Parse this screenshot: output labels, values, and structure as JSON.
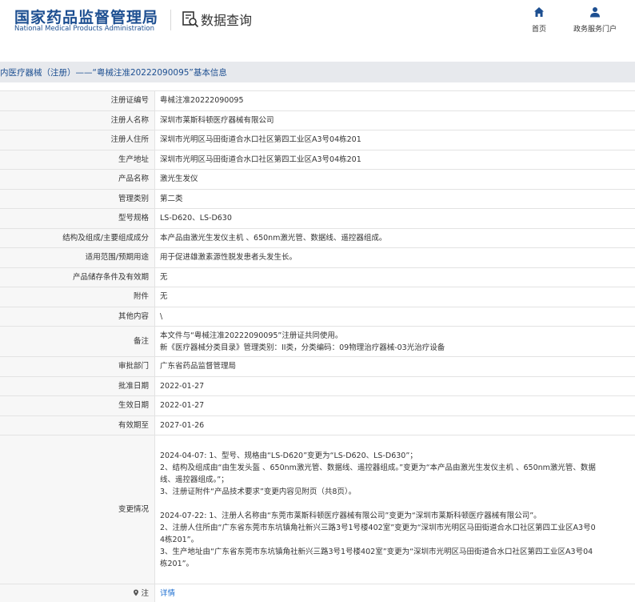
{
  "header": {
    "logo_cn": "国家药品监督管理局",
    "logo_en": "National Medical Products Administration",
    "section_title": "数据查询",
    "nav": {
      "home": "首页",
      "service": "政务服务门户"
    }
  },
  "breadcrumb": "内医疗器械（注册）——“粤械注准20222090095”基本信息",
  "colors": {
    "brand_blue": "#1d4f91",
    "link_blue": "#1d6fd1",
    "label_bg": "#f7f7f7",
    "crumb_bg": "#e7e9ed"
  },
  "rows": [
    {
      "label": "注册证编号",
      "value": "粤械注准20222090095"
    },
    {
      "label": "注册人名称",
      "value": "深圳市莱斯科顿医疗器械有限公司"
    },
    {
      "label": "注册人住所",
      "value": "深圳市光明区马田街道合水口社区第四工业区A3号04栋201"
    },
    {
      "label": "生产地址",
      "value": "深圳市光明区马田街道合水口社区第四工业区A3号04栋201"
    },
    {
      "label": "产品名称",
      "value": "激光生发仪"
    },
    {
      "label": "管理类别",
      "value": "第二类"
    },
    {
      "label": "型号规格",
      "value": "LS-D620、LS-D630"
    },
    {
      "label": "结构及组成/主要组成成分",
      "value": "本产品由激光生发仪主机 、650nm激光管、数据线、遥控器组成。"
    },
    {
      "label": "适用范围/预期用途",
      "value": "用于促进雄激素源性脱发患者头发生长。"
    },
    {
      "label": "产品储存条件及有效期",
      "value": "无"
    },
    {
      "label": "附件",
      "value": "无"
    },
    {
      "label": "其他内容",
      "value": "\\"
    }
  ],
  "remark": {
    "label": "备注",
    "lines": [
      "本文件与“粤械注准20222090095”注册证共同使用。",
      "新《医疗器械分类目录》管理类别：II类，分类编码：09物理治疗器械-03光治疗设备"
    ]
  },
  "rows2": [
    {
      "label": "审批部门",
      "value": "广东省药品监督管理局"
    },
    {
      "label": "批准日期",
      "value": "2022-01-27"
    },
    {
      "label": "生效日期",
      "value": "2022-01-27"
    },
    {
      "label": "有效期至",
      "value": "2027-01-26"
    }
  ],
  "changes": {
    "label": "变更情况",
    "block1": [
      "2024-04-07: 1、型号、规格由“LS-D620”变更为“LS-D620、LS-D630”；",
      "2、结构及组成由“由生发头盔 、650nm激光管、数据线、遥控器组成。”变更为“本产品由激光生发仪主机 、650nm激光管、数据",
      "线、遥控器组成。”；",
      "3、注册证附件“产品技术要求”变更内容见附页（共8页）。"
    ],
    "block2": [
      "2024-07-22: 1、注册人名称由“东莞市莱斯科顿医疗器械有限公司”变更为“深圳市莱斯科顿医疗器械有限公司”。",
      "2、注册人住所由“广东省东莞市东坑镇角社新兴三路3号1号楼402室”变更为“深圳市光明区马田街道合水口社区第四工业区A3号0",
      "4栋201”。",
      "3、生产地址由“广东省东莞市东坑镇角社新兴三路3号1号楼402室”变更为“深圳市光明区马田街道合水口社区第四工业区A3号04",
      "栋201”。"
    ]
  },
  "note_row": {
    "label": "注",
    "link": "详情",
    "icon": "map-pin-icon"
  }
}
